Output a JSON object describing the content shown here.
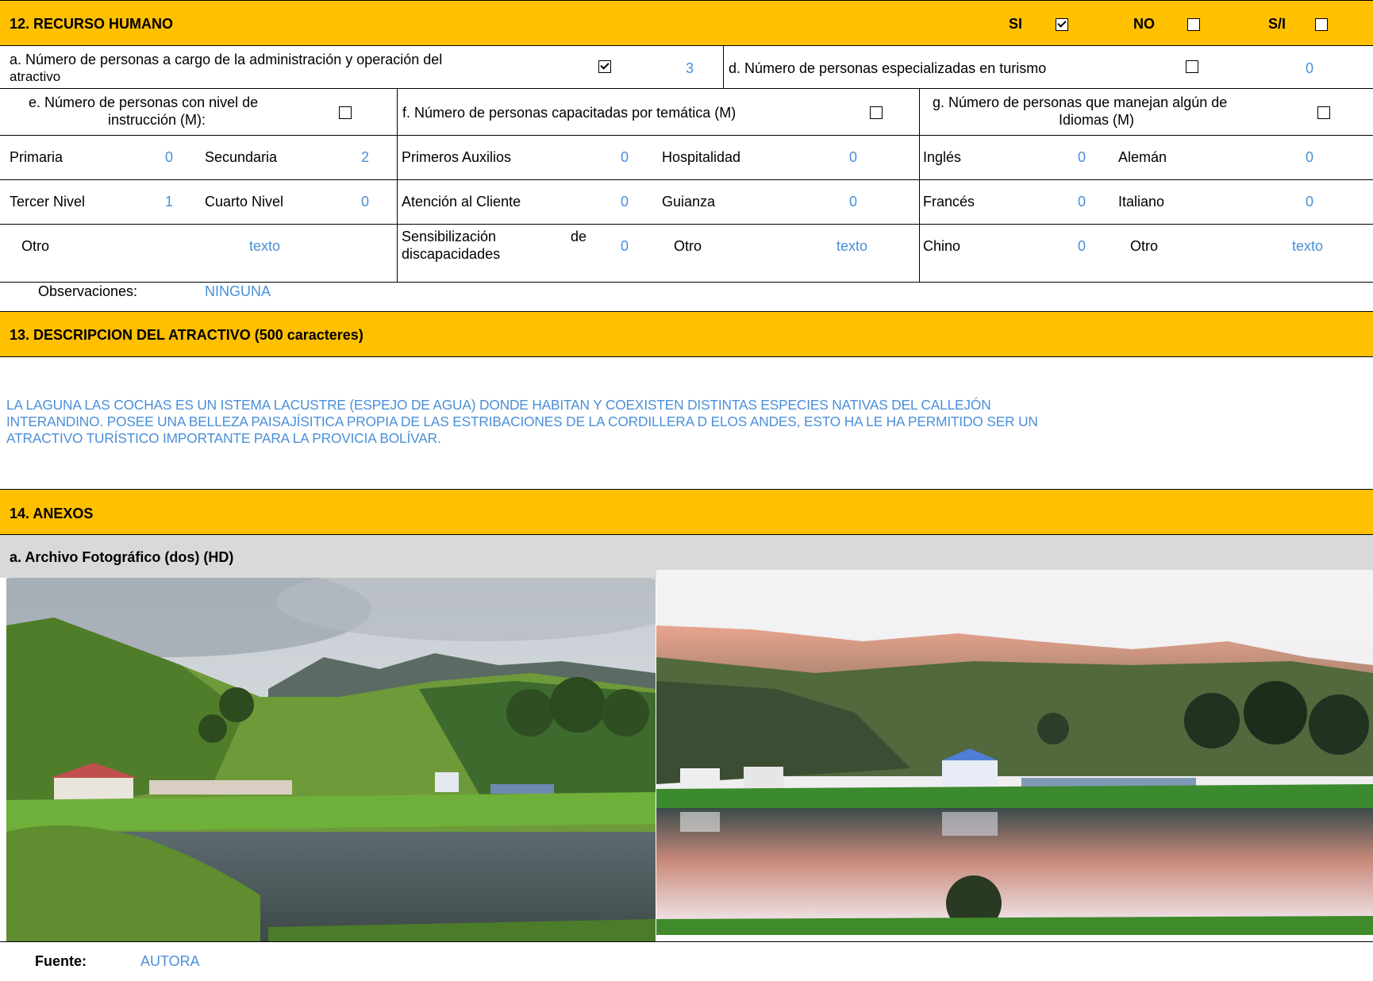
{
  "s12": {
    "title": "12. RECURSO HUMANO",
    "si_label": "SI",
    "no_label": "NO",
    "sin_label": "S/I",
    "q_a_line1": "a. Número de personas a cargo de la administración y operación del",
    "q_a_line2": "atractivo",
    "q_a_value": "3",
    "q_d": "d. Número de personas especializadas en turismo",
    "q_d_value": "0",
    "q_e_line1": "e. Número de personas con nivel de",
    "q_e_line2": "instrucción (M):",
    "q_f": "f. Número de personas capacitadas por temática (M)",
    "q_g_line1": "g. Número de personas que manejan algún de",
    "q_g_line2": "Idiomas (M)",
    "edu": {
      "primaria": "Primaria",
      "primaria_v": "0",
      "secundaria": "Secundaria",
      "secundaria_v": "2",
      "tercer": "Tercer Nivel",
      "tercer_v": "1",
      "cuarto": "Cuarto Nivel",
      "cuarto_v": "0",
      "otro": "Otro",
      "otro_v": "texto"
    },
    "cap": {
      "auxilios": "Primeros Auxilios",
      "auxilios_v": "0",
      "hospitalidad": "Hospitalidad",
      "hospitalidad_v": "0",
      "atencion": "Atención al Cliente",
      "atencion_v": "0",
      "guianza": "Guianza",
      "guianza_v": "0",
      "sens_1": "Sensibilización",
      "sens_de": "de",
      "sens_2": "discapacidades",
      "sens_v": "0",
      "otro": "Otro",
      "otro_v": "texto"
    },
    "idi": {
      "ingles": "Inglés",
      "ingles_v": "0",
      "aleman": "Alemán",
      "aleman_v": "0",
      "frances": "Francés",
      "frances_v": "0",
      "italiano": "Italiano",
      "italiano_v": "0",
      "chino": "Chino",
      "chino_v": "0",
      "otro": "Otro",
      "otro_v": "texto"
    },
    "obs_label": "Observaciones:",
    "obs_value": "NINGUNA"
  },
  "s13": {
    "title": "13. DESCRIPCION DEL ATRACTIVO (500 caracteres)",
    "line1": "LA LAGUNA LAS COCHAS ES UN ISTEMA LACUSTRE (ESPEJO DE AGUA) DONDE HABITAN Y COEXISTEN DISTINTAS ESPECIES NATIVAS DEL CALLEJÓN",
    "line2": "INTERANDINO. POSEE UNA BELLEZA PAISAJÍSITICA PROPIA DE LAS ESTRIBACIONES DE LA CORDILLERA D ELOS ANDES, ESTO HA LE HA PERMITIDO SER UN",
    "line3": "ATRACTIVO TURÍSTICO IMPORTANTE PARA LA PROVICIA BOLÍVAR."
  },
  "s14": {
    "title": "14. ANEXOS",
    "subtitle": "a. Archivo Fotográfico (dos) (HD)",
    "fuente_label": "Fuente:",
    "fuente_value": "AUTORA"
  },
  "colors": {
    "header": "#ffc000",
    "value_blue": "#4a8fd9",
    "subheader": "#d9d9d9"
  }
}
